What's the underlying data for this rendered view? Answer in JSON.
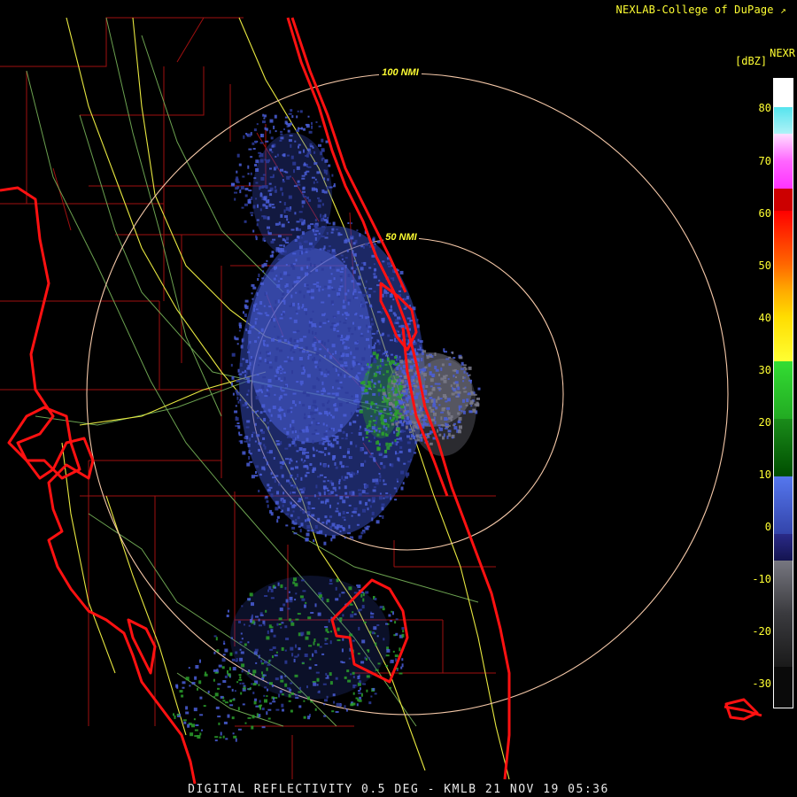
{
  "header": {
    "credit": "NEXLAB-College of DuPage",
    "credit_mark": "↗"
  },
  "footer": {
    "caption": "DIGITAL REFLECTIVITY 0.5 DEG - KMLB 21 NOV 19 05:36"
  },
  "range_rings": [
    {
      "label": "100 NMI"
    },
    {
      "label": "50 NMI"
    }
  ],
  "legend": {
    "title": "NEXR",
    "unit": "[dBZ]",
    "ticks": [
      "80",
      "70",
      "60",
      "50",
      "40",
      "30",
      "20",
      "10",
      "0",
      "-10",
      "-20",
      "-30"
    ],
    "colors": {
      "above_80": "#ffffff",
      "c80": "#55e4ee",
      "c70": "#ff33ff",
      "c60": "#ff0000",
      "c50": "#ff8800",
      "c40": "#ffff00",
      "c30": "#33cc33",
      "c20": "#006600",
      "c10": "#4466dd",
      "c0": "#1a1a77",
      "cm10": "#666666",
      "cm30": "#111111"
    }
  },
  "map_colors": {
    "coastline": "#ff1111",
    "county": "#a01010",
    "highway": "#e8e840",
    "road": "#7fbf5f",
    "ring": "#f5c8a8",
    "echo_light": "#4a5ed8",
    "echo_dark": "#2d3b9a",
    "echo_green": "#2ca02c",
    "echo_gray": "#7a7a8a"
  }
}
